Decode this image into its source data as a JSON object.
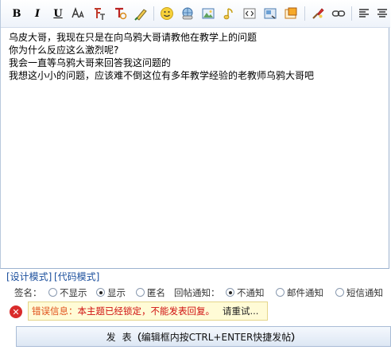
{
  "toolbar": {
    "bold": "B",
    "italic": "I",
    "underline": "U"
  },
  "content": {
    "lines": [
      "乌皮大哥，我现在只是在向乌鸦大哥请教他在教学上的问题",
      "你为什么反应这么激烈呢?",
      "我会一直等乌鸦大哥来回答我这问题的",
      "我想这小小的问题，应该难不倒这位有多年教学经验的老教师乌鸦大哥吧"
    ]
  },
  "modes": {
    "design": "[设计模式]",
    "code": "[代码模式]"
  },
  "options": {
    "signature_label": "签名：",
    "sig_hide": "不显示",
    "sig_show": "显示",
    "anonymous": "匿名",
    "notify_label": "回帖通知：",
    "notify_none": "不通知",
    "notify_mail": "邮件通知",
    "notify_sms": "短信通知"
  },
  "error": {
    "label": "错误信息：",
    "message": "本主题已经锁定，不能发表回复。",
    "retry": "请重试..."
  },
  "submit": {
    "label_a": "发",
    "label_b": "表",
    "hint_open": "（",
    "hint": "编辑框内按CTRL+ENTER快捷发帖",
    "hint_close": "）"
  }
}
